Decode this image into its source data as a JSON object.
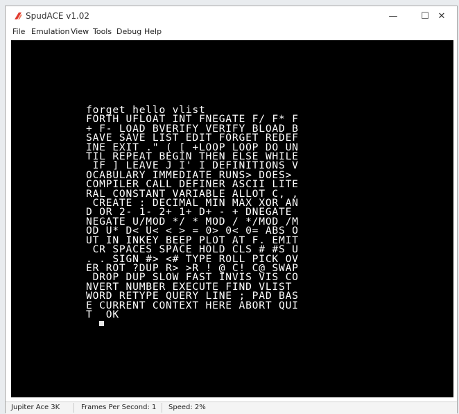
{
  "window": {
    "title": "SpudACE v1.02",
    "controls": {
      "minimize": "—",
      "maximize": "☐",
      "close": "✕"
    },
    "icon": "spudace-app-icon"
  },
  "menu": {
    "items": [
      "File",
      "Emulation",
      "View",
      "Tools",
      "Debug",
      "Help"
    ]
  },
  "screen": {
    "lines": [
      "forget hello vlist",
      "FORTH UFLOAT INT FNEGATE F/ F* F",
      "+ F- LOAD BVERIFY VERIFY BLOAD B",
      "SAVE SAVE LIST EDIT FORGET REDEF",
      "INE EXIT .\" ( [ +LOOP LOOP DO UN",
      "TIL REPEAT BEGIN THEN ELSE WHILE",
      " IF ] LEAVE J I' I DEFINITIONS V",
      "OCABULARY IMMEDIATE RUNS> DOES>",
      "COMPILER CALL DEFINER ASCII LITE",
      "RAL CONSTANT VARIABLE ALLOT C, ,",
      " CREATE : DECIMAL MIN MAX XOR AN",
      "D OR 2- 1- 2+ 1+ D+ - + DNEGATE",
      "NEGATE U/MOD */ * MOD / */MOD /M",
      "OD U* D< U< < > = 0> 0< 0= ABS O",
      "UT IN INKEY BEEP PLOT AT F. EMIT",
      " CR SPACES SPACE HOLD CLS # #S U",
      ". . SIGN #> <# TYPE ROLL PICK OV",
      "ER ROT ?DUP R> >R ! @ C! C@ SWAP",
      " DROP DUP SLOW FAST INVIS VIS CO",
      "NVERT NUMBER EXECUTE FIND VLIST",
      "WORD RETYPE QUERY LINE ; PAD BAS",
      "E CURRENT CONTEXT HERE ABORT QUI",
      "T  OK"
    ]
  },
  "status": {
    "machine": "Jupiter Ace 3K",
    "fps": "Frames Per Second: 1",
    "speed": "Speed: 2%"
  },
  "colors": {
    "screen_bg": "#000000",
    "screen_text": "#ffffff",
    "icon_red": "#e03a2f"
  }
}
